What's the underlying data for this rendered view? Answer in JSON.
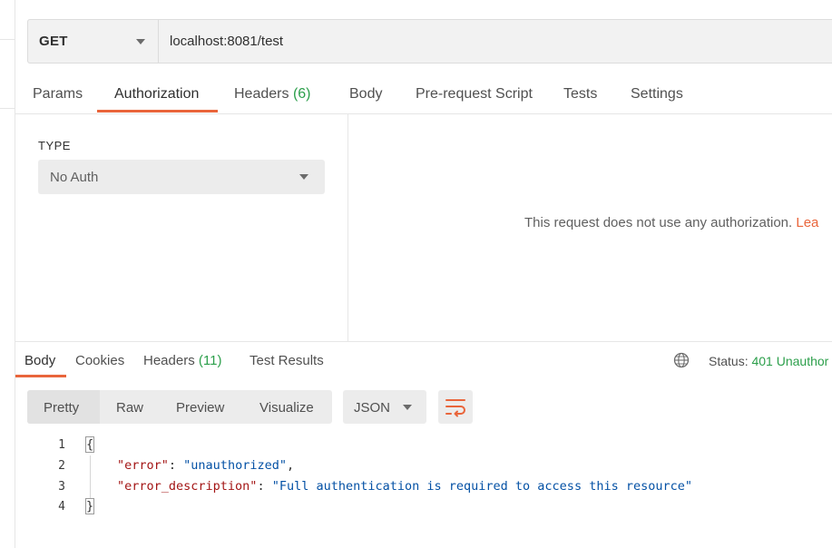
{
  "request": {
    "method": "GET",
    "url": "localhost:8081/test",
    "tabs": [
      {
        "label": "Params",
        "count": ""
      },
      {
        "label": "Authorization",
        "count": ""
      },
      {
        "label": "Headers",
        "count": "(6)"
      },
      {
        "label": "Body",
        "count": ""
      },
      {
        "label": "Pre-request Script",
        "count": ""
      },
      {
        "label": "Tests",
        "count": ""
      },
      {
        "label": "Settings",
        "count": ""
      }
    ],
    "active_tab": "Authorization"
  },
  "auth": {
    "type_label": "TYPE",
    "type_value": "No Auth",
    "message": "This request does not use any authorization.",
    "message_link": "Lea"
  },
  "response": {
    "tabs": [
      {
        "label": "Body",
        "count": ""
      },
      {
        "label": "Cookies",
        "count": ""
      },
      {
        "label": "Headers",
        "count": "(11)"
      },
      {
        "label": "Test Results",
        "count": ""
      }
    ],
    "active_tab": "Body",
    "status_label": "Status:",
    "status_value": "401 Unauthor",
    "views": [
      "Pretty",
      "Raw",
      "Preview",
      "Visualize"
    ],
    "active_view": "Pretty",
    "format": "JSON",
    "lines": [
      "1",
      "2",
      "3",
      "4"
    ],
    "code": {
      "open_brace": "{",
      "close_brace": "}",
      "key1": "\"error\"",
      "val1": "\"unauthorized\"",
      "key2": "\"error_description\"",
      "val2": "\"Full authentication is required to access this resource\""
    }
  },
  "colors": {
    "accent": "#e9653b",
    "count_green": "#2c9f4b",
    "json_key": "#a31515",
    "json_string": "#0451a5"
  },
  "icons": [
    "chevron-down-icon",
    "globe-icon",
    "wrap-lines-icon"
  ]
}
